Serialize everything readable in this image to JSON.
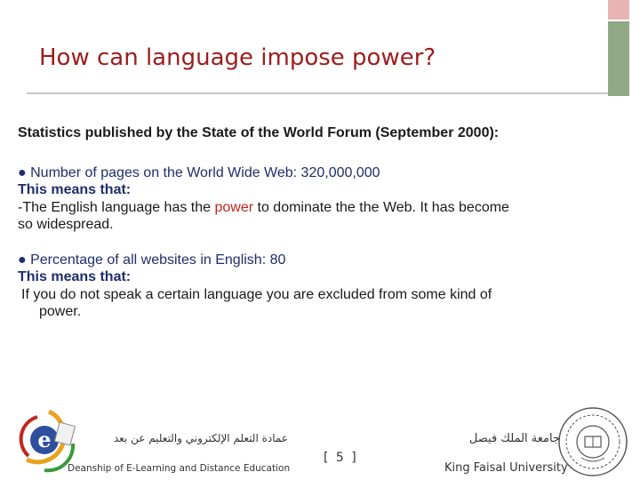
{
  "slide": {
    "title": "How can language impose power?",
    "subtitle": "Statistics published by the State of the World Forum (September 2000):",
    "point1": {
      "bullet_line": "● Number of pages on the World Wide Web: 320,000,000",
      "means_label": "This means that:",
      "explain_before": "-The English language has the ",
      "explain_highlight": "power",
      "explain_after": " to dominate the the Web. It has become",
      "explain_cont": "so widespread."
    },
    "point2": {
      "bullet_line": "● Percentage of all websites in English: 80",
      "means_label": "This means that:",
      "explain_line1": "If you do not speak a certain language you are excluded from some kind of",
      "explain_line2": "power."
    }
  },
  "footer": {
    "left_arabic": "عمادة التعلم الإلكتروني والتعليم عن بعد",
    "left_english": "Deanship of E-Learning and Distance Education",
    "page_number": "[ 5 ]",
    "right_arabic": "جامعة الملك فيصل",
    "right_english": "King Faisal University"
  },
  "colors": {
    "title": "#9b1d1d",
    "body_text": "#1f2d6b",
    "highlight": "#c0261f",
    "accent_bar": "#8fa985",
    "accent_bar_top": "#e8b3b3"
  },
  "icons": {
    "left_logo": "e-learning-logo-icon",
    "right_logo": "university-seal-icon"
  }
}
